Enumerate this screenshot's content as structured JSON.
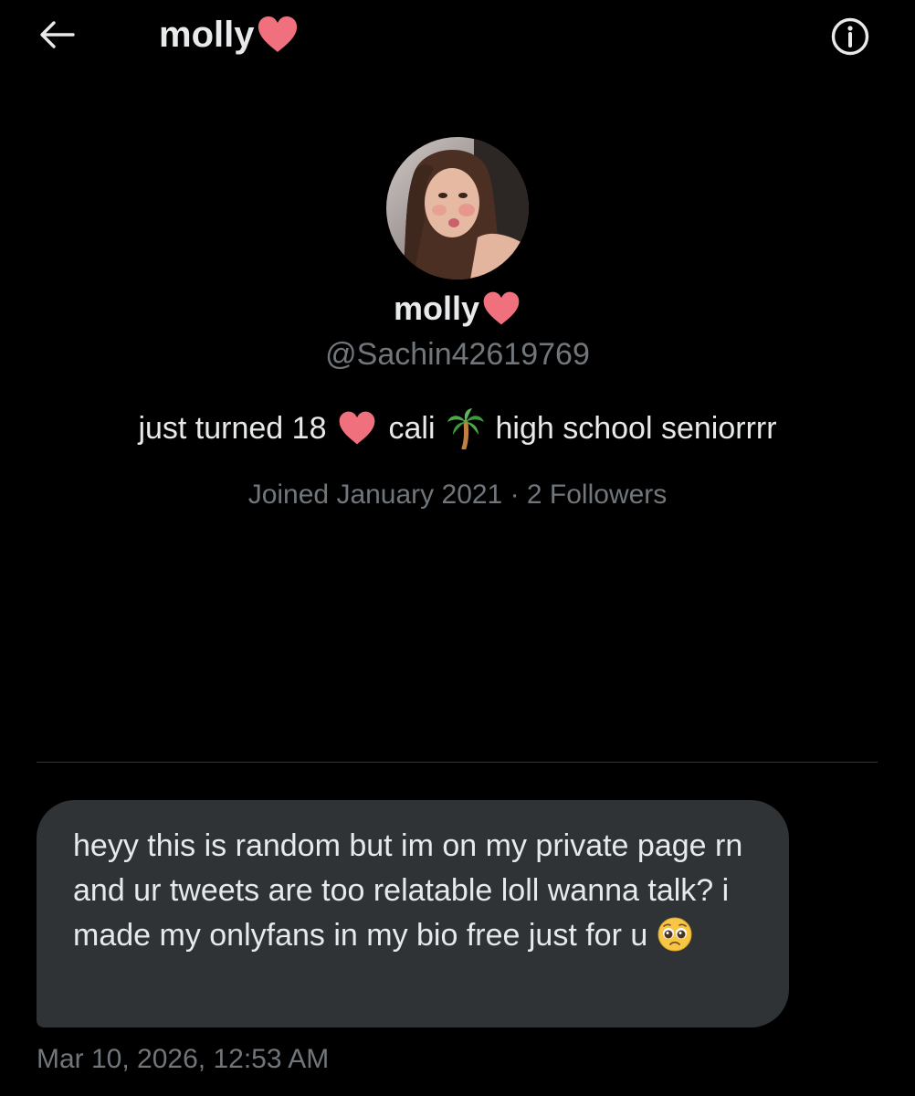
{
  "header": {
    "title": "molly",
    "back_icon": "arrow-left-icon",
    "info_icon": "info-icon",
    "heart_color": "#f0707e"
  },
  "profile": {
    "name": "molly",
    "handle": "@Sachin42619769",
    "bio": {
      "part1": "just turned 18",
      "part2": "cali",
      "part3": "high school seniorrrr",
      "icons": [
        "pink-heart-icon",
        "palm-tree-icon"
      ]
    },
    "meta": "Joined January 2021 · 2 Followers"
  },
  "message": {
    "text": "heyy this is random but im on my private page rn and ur tweets are too relatable loll wanna talk? i made my onlyfans in my bio free just for u",
    "emoji": "pleading-face-icon",
    "timestamp": "Mar 10, 2026, 12:53 AM",
    "bubble_color": "#2f3336"
  },
  "colors": {
    "background": "#000000",
    "primary_text": "#e7e9ea",
    "secondary_text": "#71767b"
  }
}
